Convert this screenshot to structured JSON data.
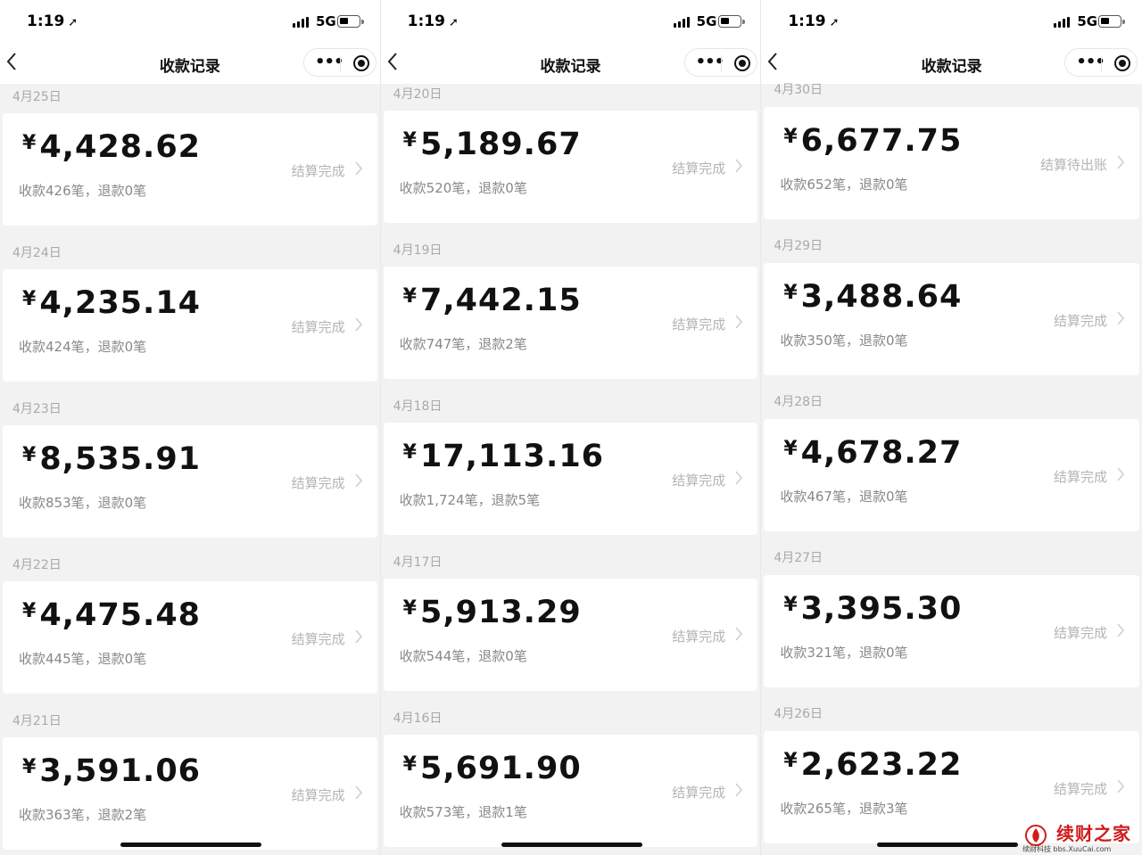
{
  "panels": [
    {
      "status_time": "1:19",
      "network": "5G",
      "title": "收款记录",
      "records": [
        {
          "date": "4月25日",
          "yen": "¥",
          "amount": "4,428.62",
          "summary": "收款426笔，退款0笔",
          "status": "结算完成"
        },
        {
          "date": "4月24日",
          "yen": "¥",
          "amount": "4,235.14",
          "summary": "收款424笔，退款0笔",
          "status": "结算完成"
        },
        {
          "date": "4月23日",
          "yen": "¥",
          "amount": "8,535.91",
          "summary": "收款853笔，退款0笔",
          "status": "结算完成"
        },
        {
          "date": "4月22日",
          "yen": "¥",
          "amount": "4,475.48",
          "summary": "收款445笔，退款0笔",
          "status": "结算完成"
        },
        {
          "date": "4月21日",
          "yen": "¥",
          "amount": "3,591.06",
          "summary": "收款363笔，退款2笔",
          "status": "结算完成"
        }
      ]
    },
    {
      "status_time": "1:19",
      "network": "5G",
      "title": "收款记录",
      "records": [
        {
          "date": "4月20日",
          "yen": "¥",
          "amount": "5,189.67",
          "summary": "收款520笔，退款0笔",
          "status": "结算完成"
        },
        {
          "date": "4月19日",
          "yen": "¥",
          "amount": "7,442.15",
          "summary": "收款747笔，退款2笔",
          "status": "结算完成"
        },
        {
          "date": "4月18日",
          "yen": "¥",
          "amount": "17,113.16",
          "summary": "收款1,724笔，退款5笔",
          "status": "结算完成"
        },
        {
          "date": "4月17日",
          "yen": "¥",
          "amount": "5,913.29",
          "summary": "收款544笔，退款0笔",
          "status": "结算完成"
        },
        {
          "date": "4月16日",
          "yen": "¥",
          "amount": "5,691.90",
          "summary": "收款573笔，退款1笔",
          "status": "结算完成"
        }
      ]
    },
    {
      "status_time": "1:19",
      "network": "5G",
      "title": "收款记录",
      "records": [
        {
          "date": "4月30日",
          "yen": "¥",
          "amount": "6,677.75",
          "summary": "收款652笔，退款0笔",
          "status": "结算待出账"
        },
        {
          "date": "4月29日",
          "yen": "¥",
          "amount": "3,488.64",
          "summary": "收款350笔，退款0笔",
          "status": "结算完成"
        },
        {
          "date": "4月28日",
          "yen": "¥",
          "amount": "4,678.27",
          "summary": "收款467笔，退款0笔",
          "status": "结算完成"
        },
        {
          "date": "4月27日",
          "yen": "¥",
          "amount": "3,395.30",
          "summary": "收款321笔，退款0笔",
          "status": "结算完成"
        },
        {
          "date": "4月26日",
          "yen": "¥",
          "amount": "2,623.22",
          "summary": "收款265笔，退款3笔",
          "status": "结算完成"
        }
      ]
    }
  ],
  "watermark": {
    "text": "续财之家",
    "sub": "续财科技 bbs.XuuCai.com"
  },
  "icons": {
    "back": "chevron-left-icon",
    "more": "more-dots-icon",
    "close": "target-circle-icon",
    "row": "chevron-right-icon",
    "location": "location-arrow-icon"
  },
  "colors": {
    "background": "#f2f2f2",
    "card": "#ffffff",
    "amount": "#111111",
    "muted": "#888888",
    "status": "#b5b5b5",
    "watermark": "#d11c1c"
  }
}
